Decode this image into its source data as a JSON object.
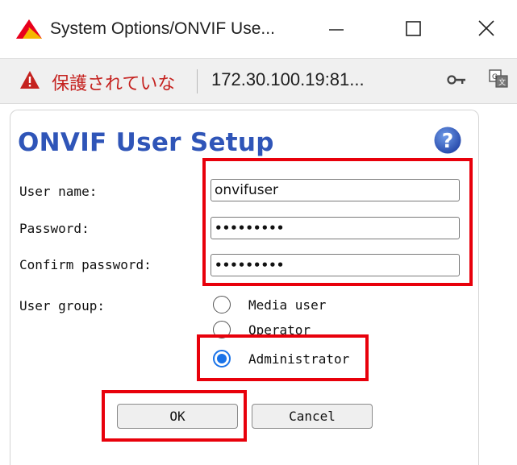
{
  "window": {
    "title": "System Options/ONVIF Use...",
    "min_icon": "minimize-icon",
    "max_icon": "maximize-icon",
    "close_icon": "close-icon"
  },
  "urlbar": {
    "security_label": "保護されていな",
    "url": "172.30.100.19:81..."
  },
  "dialog": {
    "heading": "ONVIF User Setup",
    "help_icon": "help-icon",
    "fields": {
      "username_label": "User name:",
      "username_value": "onvifuser",
      "password_label": "Password:",
      "password_value": "•••••••••",
      "confirm_label": "Confirm password:",
      "confirm_value": "•••••••••"
    },
    "user_group": {
      "label": "User group:",
      "options": [
        "Media user",
        "Operator",
        "Administrator"
      ],
      "selected": "Administrator"
    },
    "buttons": {
      "ok": "OK",
      "cancel": "Cancel"
    }
  },
  "colors": {
    "heading": "#2f55b8",
    "highlight": "#e8000b",
    "warning": "#c5221f",
    "radio_selected": "#1a73e8"
  }
}
